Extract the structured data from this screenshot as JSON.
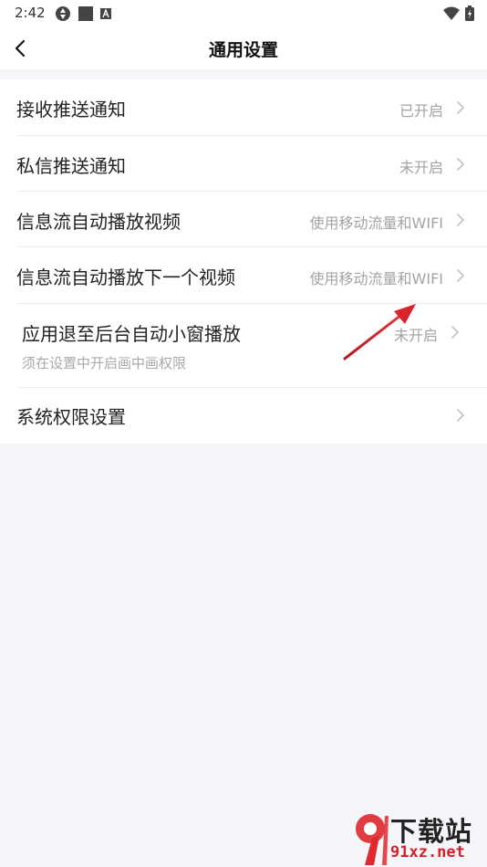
{
  "status_bar": {
    "time": "2:42",
    "icons_left": [
      "aperture-icon",
      "square-icon",
      "a-box-icon"
    ],
    "icons_right": [
      "wifi-icon",
      "battery-charging-icon"
    ]
  },
  "nav": {
    "title": "通用设置",
    "back_icon": "chevron-left-icon"
  },
  "settings": [
    {
      "label": "接收推送通知",
      "value": "已开启"
    },
    {
      "label": "私信推送通知",
      "value": "未开启"
    },
    {
      "label": "信息流自动播放视频",
      "value": "使用移动流量和WIFI"
    },
    {
      "label": "信息流自动播放下一个视频",
      "value": "使用移动流量和WIFI"
    },
    {
      "label": "应用退至后台自动小窗播放",
      "value": "未开启",
      "sub": "须在设置中开启画中画权限"
    },
    {
      "label": "系统权限设置",
      "value": ""
    }
  ],
  "watermark": {
    "text": "下载站",
    "url": "91xz.net",
    "brand_color": "#d6202b"
  },
  "colors": {
    "background": "#f5f6fa",
    "value_text": "#a3a3a8",
    "annotation_arrow": "#d8232a"
  }
}
